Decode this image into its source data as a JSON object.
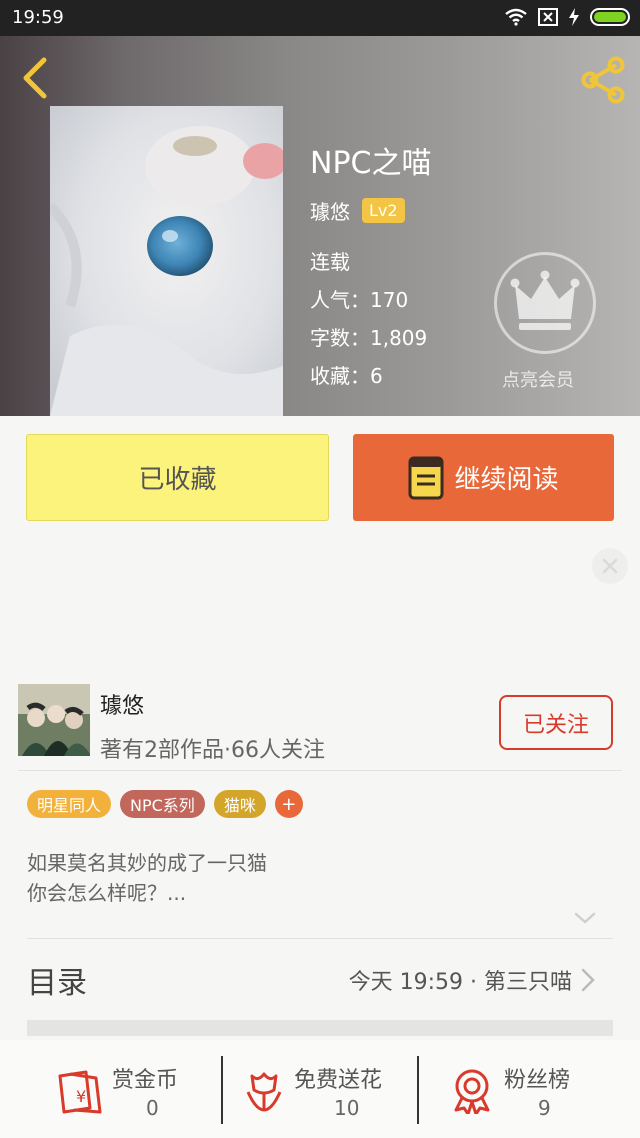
{
  "status_bar": {
    "time": "19:59"
  },
  "book": {
    "title": "NPC之喵",
    "author": "璩悠",
    "level": "Lv2",
    "status": "连载",
    "popularity": "人气：170",
    "word_count": "字数：1,809",
    "favorites": "收藏：6",
    "vip_label": "点亮会员"
  },
  "actions": {
    "favorited_label": "已收藏",
    "continue_label": "继续阅读"
  },
  "author_card": {
    "name": "璩悠",
    "subtitle": "著有2部作品·66人关注",
    "follow_label": "已关注"
  },
  "tags": [
    {
      "label": "明星同人",
      "color": "#f1b13a"
    },
    {
      "label": "NPC系列",
      "color": "#c2675b"
    },
    {
      "label": "猫咪",
      "color": "#d4a52b"
    }
  ],
  "tag_add": "+",
  "intro": {
    "line1": "如果莫名其妙的成了一只猫",
    "line2": "你会怎么样呢？..."
  },
  "toc": {
    "label": "目录",
    "latest": "今天 19:59 · 第三只喵"
  },
  "bottom_bar": {
    "reward": {
      "label": "赏金币",
      "count": "0"
    },
    "flowers": {
      "label": "免费送花",
      "count": "10"
    },
    "fans": {
      "label": "粉丝榜",
      "count": "9"
    }
  },
  "colors": {
    "accent": "#e8683a",
    "favorite_bg": "#fbf37b",
    "follow": "#d83a2c",
    "level_badge": "#f4c544"
  }
}
